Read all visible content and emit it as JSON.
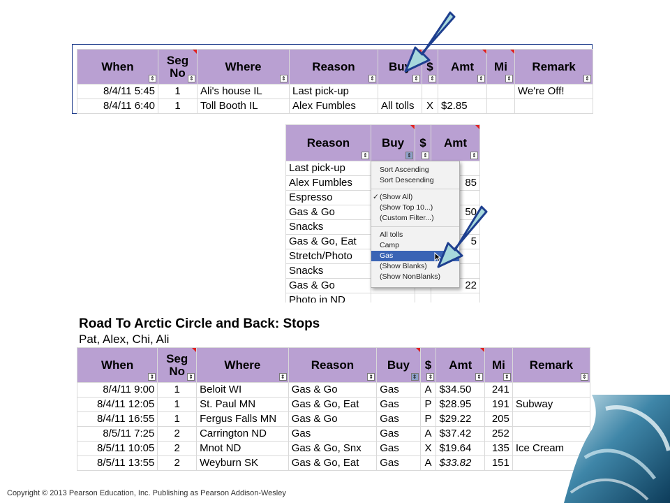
{
  "colors": {
    "header_bg": "#b9a0d2",
    "frame_border": "#1f3d8c",
    "arrow_fill": "#a7d8dc",
    "arrow_stroke": "#1e3f8f",
    "menu_highlight": "#3a64b5",
    "comment_marker": "#e02020"
  },
  "table1": {
    "headers": [
      "When",
      "Seg No",
      "Where",
      "Reason",
      "Buy",
      "$",
      "Amt",
      "Mi",
      "Remark"
    ],
    "rows": [
      [
        "8/4/11 5:45",
        "1",
        "Ali's house IL",
        "Last pick-up",
        "",
        "",
        "",
        "",
        "We're Off!"
      ],
      [
        "8/4/11 6:40",
        "1",
        "Toll Booth IL",
        "Alex Fumbles",
        "All tolls",
        "X",
        "$2.85",
        "",
        ""
      ]
    ]
  },
  "table2": {
    "headers": [
      "Reason",
      "Buy",
      "$",
      "Amt"
    ],
    "rows": [
      [
        "Last pick-up",
        "",
        "",
        ""
      ],
      [
        "Alex Fumbles",
        "",
        "",
        "85"
      ],
      [
        "Espresso",
        "",
        "",
        ""
      ],
      [
        "Gas & Go",
        "",
        "",
        "50"
      ],
      [
        "Snacks",
        "",
        "",
        ""
      ],
      [
        "Gas & Go, Eat",
        "",
        "",
        "5"
      ],
      [
        "Stretch/Photo",
        "",
        "",
        ""
      ],
      [
        "Snacks",
        "",
        "",
        ""
      ],
      [
        "Gas & Go",
        "",
        "",
        "22"
      ],
      [
        "Photo in ND",
        "",
        "",
        ""
      ]
    ]
  },
  "menu": {
    "sort": [
      "Sort Ascending",
      "Sort Descending"
    ],
    "filters": [
      "(Show All)",
      "(Show Top 10...)",
      "(Custom Filter...)"
    ],
    "values": [
      "All tolls",
      "Camp",
      "Gas",
      "(Show Blanks)",
      "(Show NonBlanks)"
    ],
    "checked": "(Show All)",
    "selected": "Gas"
  },
  "table3": {
    "title": "Road To Arctic Circle and Back: Stops",
    "subtitle": "Pat, Alex, Chi, Ali",
    "headers": [
      "When",
      "Seg No",
      "Where",
      "Reason",
      "Buy",
      "$",
      "Amt",
      "Mi",
      "Remark"
    ],
    "rows": [
      [
        "8/4/11 9:00",
        "1",
        "Beloit WI",
        "Gas & Go",
        "Gas",
        "A",
        "$34.50",
        "241",
        ""
      ],
      [
        "8/4/11 12:05",
        "1",
        "St. Paul MN",
        "Gas & Go, Eat",
        "Gas",
        "P",
        "$28.95",
        "191",
        "Subway"
      ],
      [
        "8/4/11 16:55",
        "1",
        "Fergus Falls MN",
        "Gas & Go",
        "Gas",
        "P",
        "$29.22",
        "205",
        ""
      ],
      [
        "8/5/11 7:25",
        "2",
        "Carrington ND",
        "Gas",
        "Gas",
        "A",
        "$37.42",
        "252",
        ""
      ],
      [
        "8/5/11 10:05",
        "2",
        "Mnot ND",
        "Gas & Go, Snx",
        "Gas",
        "X",
        "$19.64",
        "135",
        "Ice Cream"
      ],
      [
        "8/5/11 13:55",
        "2",
        "Weyburn SK",
        "Gas & Go, Eat",
        "Gas",
        "A",
        "$33.82",
        "151",
        ""
      ]
    ]
  },
  "footer": {
    "copyright": "Copyright © 2013 Pearson Education, Inc. Publishing as Pearson Addison-Wesley"
  }
}
